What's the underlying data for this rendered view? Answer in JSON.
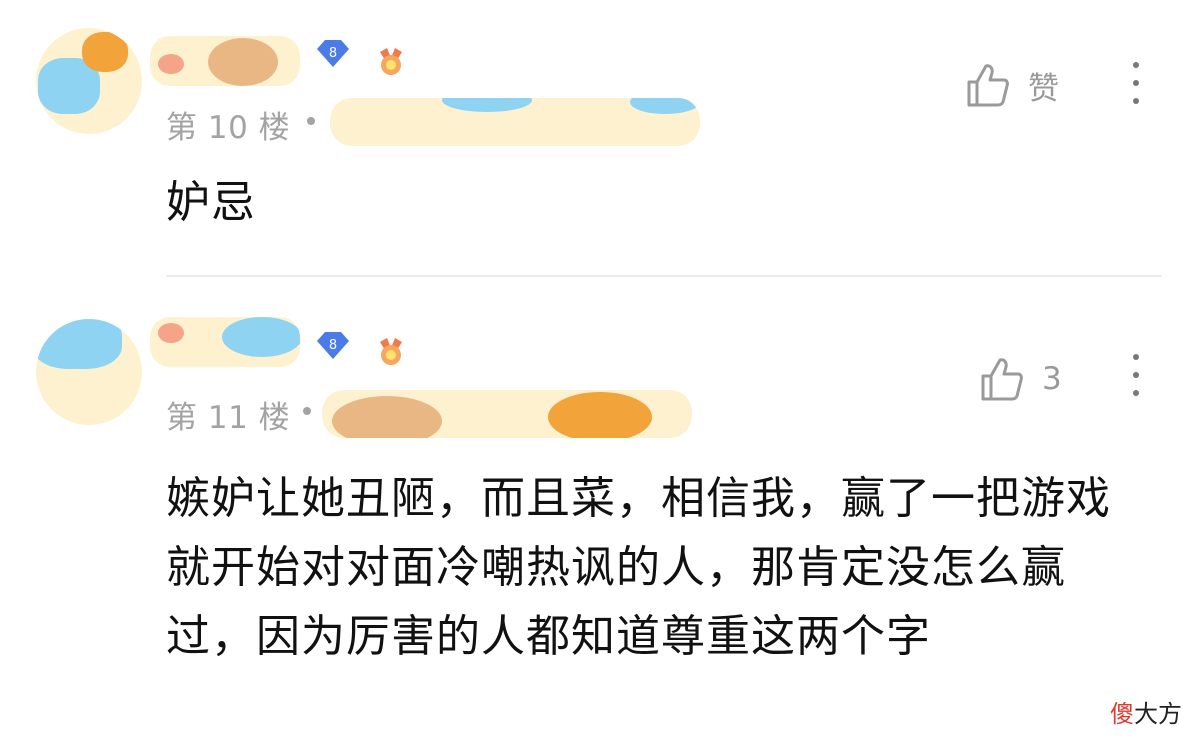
{
  "comments": [
    {
      "floor": "第 10 楼",
      "level": "8",
      "like_label": "赞",
      "text": "妒忌"
    },
    {
      "floor": "第 11 楼",
      "level": "8",
      "like_label": "3",
      "text": "嫉妒让她丑陋，而且菜，相信我，赢了一把游戏就开始对对面冷嘲热讽的人，那肯定没怎么赢过，因为厉害的人都知道尊重这两个字"
    }
  ],
  "watermark": {
    "accent": "傻",
    "rest": "大方"
  },
  "icons": {
    "like": "thumbs-up-icon",
    "more": "vertical-dots-icon",
    "level": "diamond-level-badge",
    "medal": "medal-icon"
  },
  "colors": {
    "level_badge": "#4a7be6",
    "medal": "#f07a4a",
    "meta_text": "#a3a3a3",
    "blur_fill": "#fdf1cf"
  }
}
